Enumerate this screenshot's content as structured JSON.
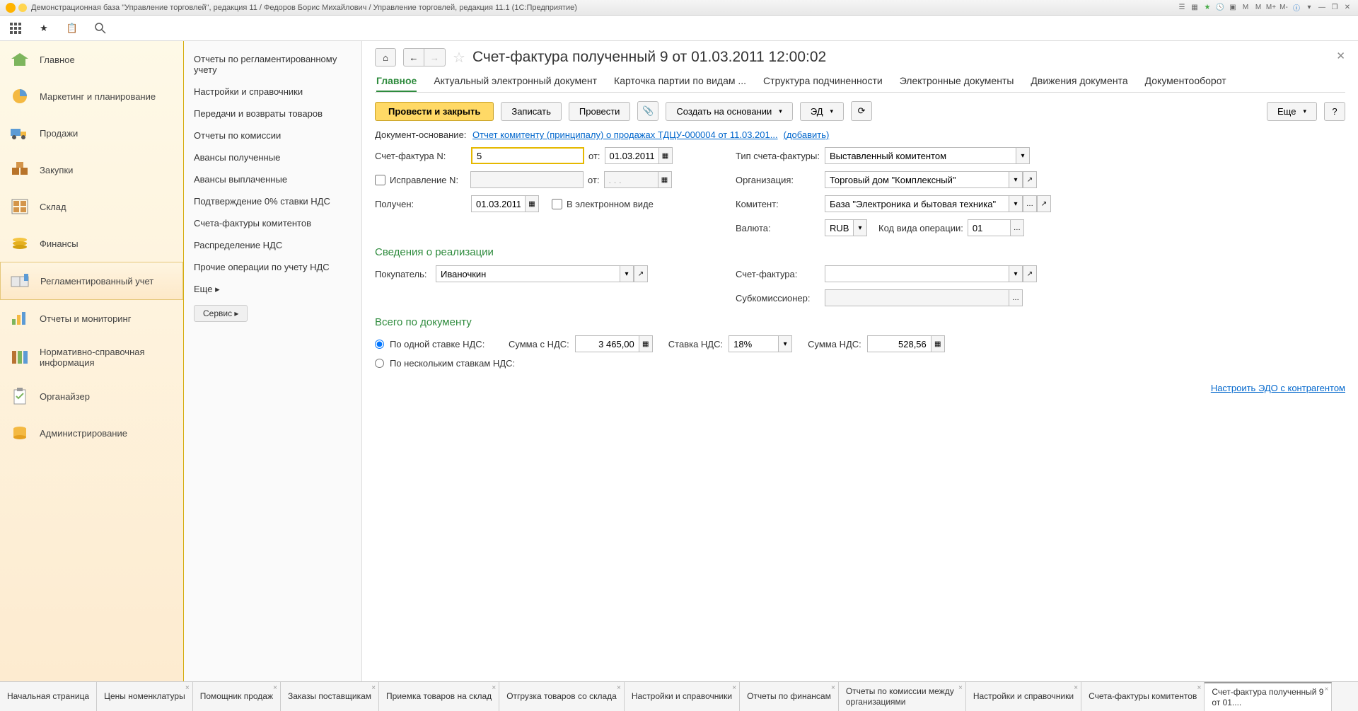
{
  "titlebar": {
    "text": "Демонстрационная база \"Управление торговлей\", редакция 11 / Федоров Борис Михайлович / Управление торговлей, редакция 11.1  (1С:Предприятие)"
  },
  "sidebar": {
    "items": [
      {
        "label": "Главное"
      },
      {
        "label": "Маркетинг и планирование"
      },
      {
        "label": "Продажи"
      },
      {
        "label": "Закупки"
      },
      {
        "label": "Склад"
      },
      {
        "label": "Финансы"
      },
      {
        "label": "Регламентированный учет"
      },
      {
        "label": "Отчеты и мониторинг"
      },
      {
        "label": "Нормативно-справочная информация"
      },
      {
        "label": "Органайзер"
      },
      {
        "label": "Администрирование"
      }
    ]
  },
  "secondnav": {
    "items": [
      "Отчеты по регламентированному учету",
      "Настройки и справочники",
      "Передачи и возвраты товаров",
      "Отчеты по комиссии",
      "Авансы полученные",
      "Авансы выплаченные",
      "Подтверждение 0% ставки НДС",
      "Счета-фактуры комитентов",
      "Распределение НДС",
      "Прочие операции по учету НДС"
    ],
    "more": "Еще ▸",
    "service": "Сервис ▸"
  },
  "doc": {
    "title": "Счет-фактура полученный 9 от 01.03.2011 12:00:02",
    "tabs": [
      "Главное",
      "Актуальный электронный документ",
      "Карточка партии по видам ...",
      "Структура подчиненности",
      "Электронные документы",
      "Движения документа",
      "Документооборот"
    ],
    "actions": {
      "post_close": "Провести и закрыть",
      "save": "Записать",
      "post": "Провести",
      "create_based": "Создать на основании",
      "ed": "ЭД",
      "more": "Еще",
      "help": "?"
    },
    "basis": {
      "label": "Документ-основание:",
      "link": "Отчет комитенту (принципалу) о продажах ТДЦУ-000004 от 11.03.201...",
      "add": "(добавить)"
    },
    "fields": {
      "sf_num_label": "Счет-фактура N:",
      "sf_num": "5",
      "from_label": "от:",
      "from_date": "01.03.2011",
      "sf_type_label": "Тип счета-фактуры:",
      "sf_type": "Выставленный комитентом",
      "corr_label": "Исправление N:",
      "corr_from_label": "от:",
      "corr_from_date": ". . .",
      "org_label": "Организация:",
      "org": "Торговый дом \"Комплексный\"",
      "received_label": "Получен:",
      "received_date": "01.03.2011",
      "electronic_label": "В электронном виде",
      "komitent_label": "Комитент:",
      "komitent": "База \"Электроника и бытовая техника\"",
      "currency_label": "Валюта:",
      "currency": "RUB",
      "opcode_label": "Код вида операции:",
      "opcode": "01"
    },
    "realization": {
      "title": "Сведения о реализации",
      "buyer_label": "Покупатель:",
      "buyer": "Иваночкин",
      "sub_label": "Субкомиссионер:",
      "sub": "",
      "sf_label": "Счет-фактура:",
      "sf": ""
    },
    "totals": {
      "title": "Всего по документу",
      "radio_single": "По одной ставке НДС:",
      "radio_multi": "По нескольким ставкам НДС:",
      "sum_vat_label": "Сумма с НДС:",
      "sum_vat": "3 465,00",
      "rate_label": "Ставка НДС:",
      "rate": "18%",
      "vat_amount_label": "Сумма НДС:",
      "vat_amount": "528,56"
    },
    "edo_link": "Настроить ЭДО с контрагентом"
  },
  "bottom_tabs": [
    "Начальная страница",
    "Цены номенклатуры",
    "Помощник продаж",
    "Заказы поставщикам",
    "Приемка товаров на склад",
    "Отгрузка товаров со склада",
    "Настройки и справочники",
    "Отчеты по финансам",
    "Отчеты по комиссии между организациями",
    "Настройки и справочники",
    "Счета-фактуры комитентов",
    "Счет-фактура полученный 9 от 01...."
  ]
}
